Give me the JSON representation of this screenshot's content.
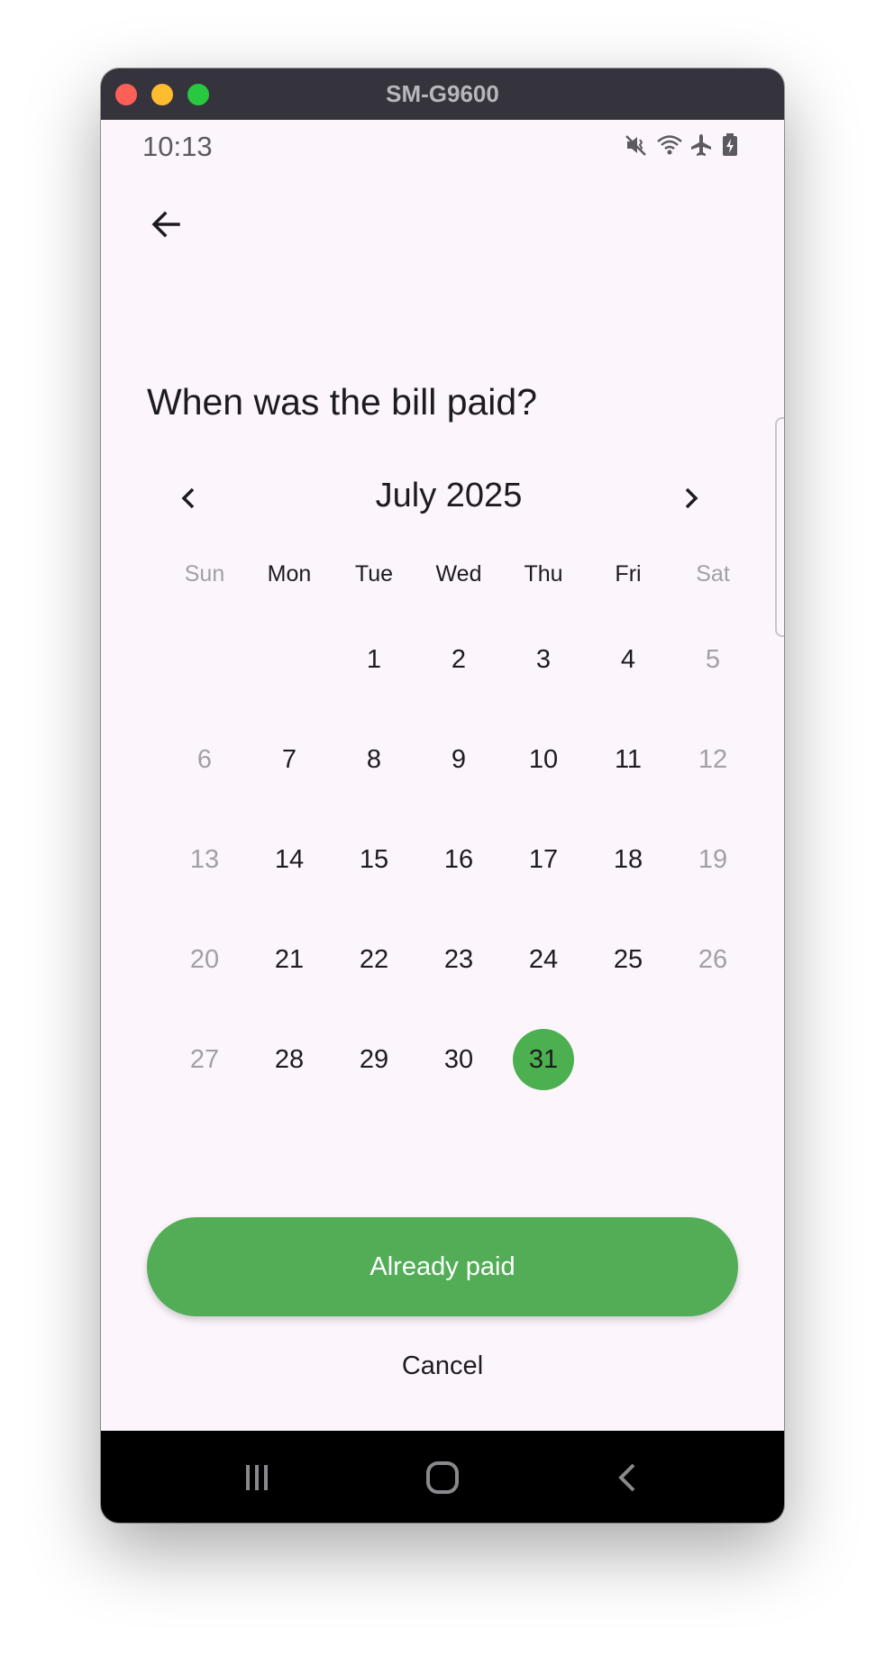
{
  "window": {
    "title": "SM-G9600"
  },
  "status_bar": {
    "time": "10:13",
    "icons": [
      "mute-vibrate-icon",
      "wifi-icon",
      "airplane-mode-icon",
      "battery-charging-icon"
    ]
  },
  "header": {
    "back_icon": "arrow-left-icon"
  },
  "question": "When was the bill paid?",
  "calendar": {
    "month_label": "July 2025",
    "prev_icon": "chevron-left-icon",
    "next_icon": "chevron-right-icon",
    "weekdays": [
      "Sun",
      "Mon",
      "Tue",
      "Wed",
      "Thu",
      "Fri",
      "Sat"
    ],
    "weeks": [
      [
        "",
        "",
        "1",
        "2",
        "3",
        "4",
        "5"
      ],
      [
        "6",
        "7",
        "8",
        "9",
        "10",
        "11",
        "12"
      ],
      [
        "13",
        "14",
        "15",
        "16",
        "17",
        "18",
        "19"
      ],
      [
        "20",
        "21",
        "22",
        "23",
        "24",
        "25",
        "26"
      ],
      [
        "27",
        "28",
        "29",
        "30",
        "31",
        "",
        ""
      ]
    ],
    "selected_day": "31",
    "selected_color": "#4caf50"
  },
  "actions": {
    "primary_label": "Already paid",
    "primary_color": "#52ad56",
    "cancel_label": "Cancel"
  },
  "nav_bar": {
    "icons": [
      "recent-apps-icon",
      "home-icon",
      "back-icon"
    ]
  }
}
